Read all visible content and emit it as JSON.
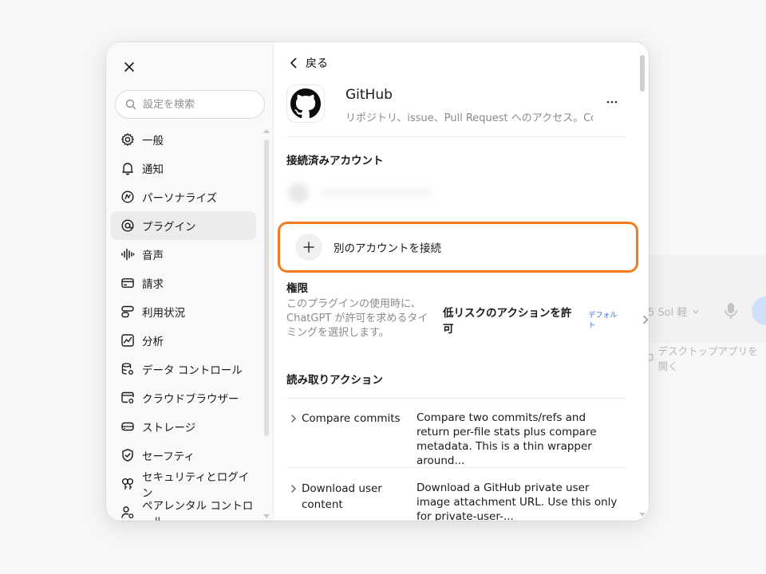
{
  "background": {
    "model_label": "5 Sol 軽",
    "desktop_label": "デスクトップアプリを開く"
  },
  "sidebar": {
    "search_placeholder": "設定を検索",
    "items": [
      {
        "label": "一般",
        "icon": "gear-icon",
        "active": false
      },
      {
        "label": "通知",
        "icon": "bell-icon",
        "active": false
      },
      {
        "label": "パーソナライズ",
        "icon": "personalize-icon",
        "active": false
      },
      {
        "label": "プラグイン",
        "icon": "plugin-icon",
        "active": true
      },
      {
        "label": "音声",
        "icon": "waveform-icon",
        "active": false
      },
      {
        "label": "請求",
        "icon": "card-icon",
        "active": false
      },
      {
        "label": "利用状況",
        "icon": "usage-icon",
        "active": false
      },
      {
        "label": "分析",
        "icon": "chart-icon",
        "active": false
      },
      {
        "label": "データ コントロール",
        "icon": "database-gear-icon",
        "active": false
      },
      {
        "label": "クラウドブラウザー",
        "icon": "cloud-browser-icon",
        "active": false
      },
      {
        "label": "ストレージ",
        "icon": "storage-icon",
        "active": false
      },
      {
        "label": "セーフティ",
        "icon": "shield-check-icon",
        "active": false
      },
      {
        "label": "セキュリティとログイン",
        "icon": "key-icon",
        "active": false
      },
      {
        "label": "ペアレンタル コントロール",
        "icon": "parental-icon",
        "active": false
      }
    ]
  },
  "main": {
    "back_label": "戻る",
    "plugin": {
      "name": "GitHub",
      "description": "リポジトリ、issue、Pull Request へのアクセス。Codex ..."
    },
    "connected_title": "接続済みアカウント",
    "connect_another_label": "別のアカウントを接続",
    "permissions": {
      "title": "権限",
      "description": "このプラグインの使用時に、ChatGPT が許可を求めるタイミングを選択します。",
      "value": "低リスクのアクションを許可",
      "badge": "デフォルト"
    },
    "read_actions_title": "読み取りアクション",
    "read_actions": [
      {
        "name": "Compare commits",
        "description": "Compare two commits/refs and return per-file stats plus compare metadata. This is a thin wrapper around..."
      },
      {
        "name": "Download user content",
        "description": "Download a GitHub private user image attachment URL. Use this only for private-user-..."
      }
    ]
  },
  "colors": {
    "highlight_border": "#f47a1f",
    "badge": "#2f6fde",
    "active_nav_bg": "#ececec"
  }
}
